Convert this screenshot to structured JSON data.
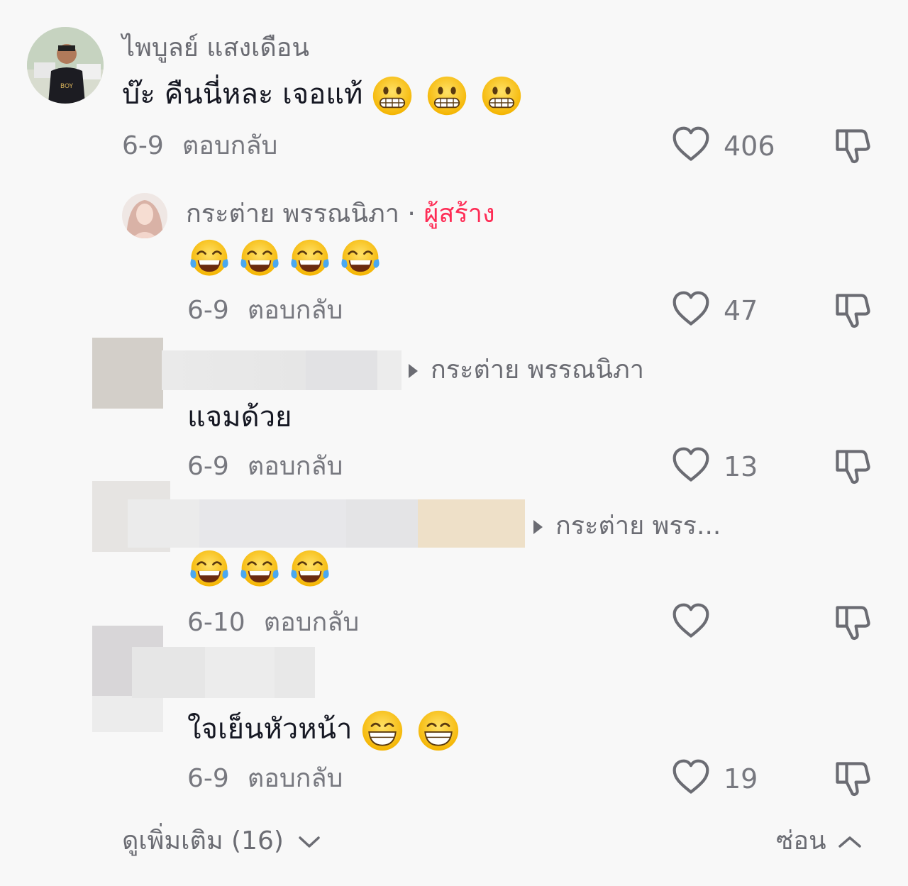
{
  "comment": {
    "author": "ไพบูลย์ แสงเดือน",
    "text": "บ๊ะ คืนนี่หละ เจอแท้",
    "date": "6-9",
    "reply_label": "ตอบกลับ",
    "likes": "406"
  },
  "replies": [
    {
      "author": "กระต่าย พรรณนิภา",
      "badge_separator": "·",
      "badge": "ผู้สร้าง",
      "date": "6-9",
      "reply_label": "ตอบกลับ",
      "likes": "47"
    },
    {
      "reply_to": "กระต่าย พรรณนิภา",
      "text": "แจมด้วย",
      "date": "6-9",
      "reply_label": "ตอบกลับ",
      "likes": "13"
    },
    {
      "reply_to": "กระต่าย พรร...",
      "date": "6-10",
      "reply_label": "ตอบกลับ",
      "likes": ""
    },
    {
      "text": "ใจเย็นหัวหน้า",
      "date": "6-9",
      "reply_label": "ตอบกลับ",
      "likes": "19"
    }
  ],
  "footer": {
    "view_more": "ดูเพิ่มเติม (16)",
    "hide": "ซ่อน"
  },
  "icons": {
    "like": "heart-outline-icon",
    "dislike": "thumbs-down-outline-icon",
    "grimace_emoji": "grimacing-face-emoji",
    "laugh_emoji": "face-with-tears-of-joy-emoji",
    "grin_emoji": "beaming-face-emoji"
  },
  "colors": {
    "background": "#f8f8f8",
    "creator_badge": "#fe2c55",
    "secondary_text": "#77787f"
  }
}
